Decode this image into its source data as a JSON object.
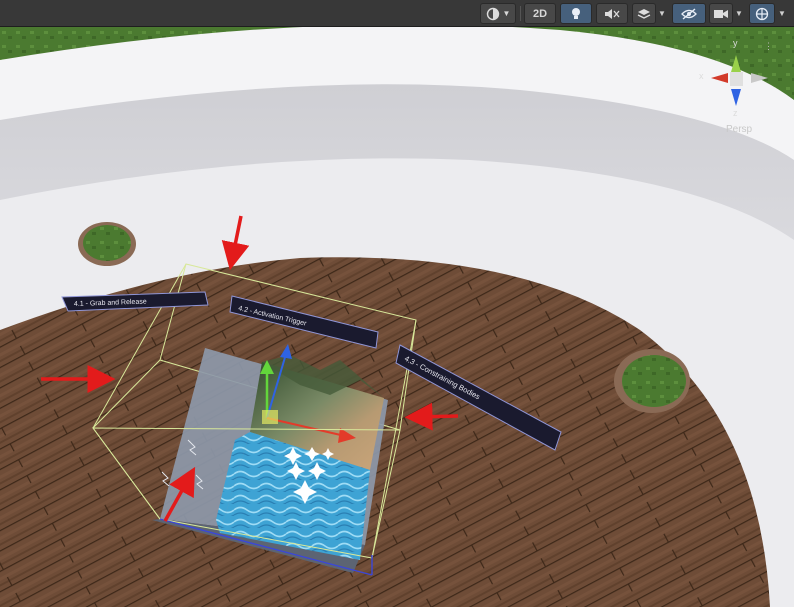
{
  "toolbar": {
    "mode_2d_label": "2D",
    "icons": [
      "shading-mode-icon",
      "light-bulb-icon",
      "audio-mute-icon",
      "effects-layers-icon",
      "visibility-hidden-icon",
      "camera-icon",
      "gizmos-globe-icon"
    ]
  },
  "scene_gizmo": {
    "axis_y": "y",
    "axis_x": "x",
    "axis_z": "z",
    "projection_label": "Persp"
  },
  "scene_labels": [
    {
      "text": "4.1 - Grab and Release"
    },
    {
      "text": "4.2 - Activation Trigger"
    },
    {
      "text": "4.3 - Constraining Bodies"
    }
  ],
  "colors": {
    "selection_outline": "#d8e89a",
    "arrow_annotation": "#e31b1b",
    "floor_wood": "#6b4a36",
    "wall": "#eaeaee",
    "grass": "#4f7d33",
    "water": "#3fa6d6"
  }
}
